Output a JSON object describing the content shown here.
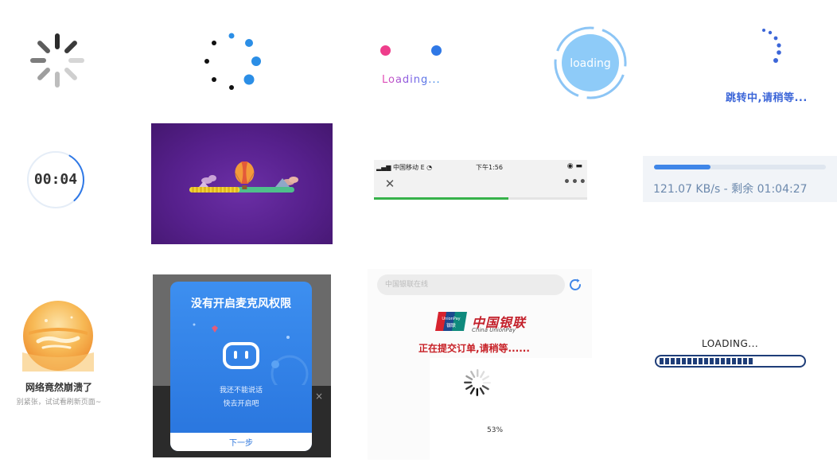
{
  "colors": {
    "accent_blue": "#2f78e6",
    "pink": "#ee3d8b",
    "green_progress": "#36b24a",
    "unionpay_red": "#c3202b",
    "bar_navy": "#1e3d78"
  },
  "cell_dots": {
    "text": "Loading..."
  },
  "cell_circle": {
    "text": "loading"
  },
  "cell_redirect": {
    "text": "跳转中,请稍等..."
  },
  "cell_countdown": {
    "text": "00:04",
    "progress": 0.3
  },
  "cell_balloon": {
    "progress": 0.48
  },
  "cell_phone": {
    "carrier": "中国移动",
    "network": "E",
    "time": "下午1:56",
    "status_icons": "◉ ▬",
    "close_icon": "close-icon",
    "more_label": "•••",
    "progress": 0.63
  },
  "cell_download": {
    "speed_text": "121.07 KB/s - 剩余 01:04:27",
    "progress": 0.33
  },
  "cell_crash": {
    "title": "网络竟然崩溃了",
    "subtitle": "别紧张，试试看刷新页面~"
  },
  "cell_dialog": {
    "title": "没有开启麦克风权限",
    "message_line1": "我还不能说话",
    "message_line2": "快去开启吧",
    "next_label": "下一步",
    "close_label": "×"
  },
  "cell_pay": {
    "search_placeholder": "中国银联在线",
    "brand_cn": "中国银联",
    "brand_en": "China UnionPay",
    "logo_top": "UnionPay",
    "logo_bottom": "银联",
    "status_text": "正在提交订单,请稍等......",
    "percent_text": "53%"
  },
  "cell_bar": {
    "label": "LOADING...",
    "filled_segments": 17,
    "progress": 0.65
  }
}
